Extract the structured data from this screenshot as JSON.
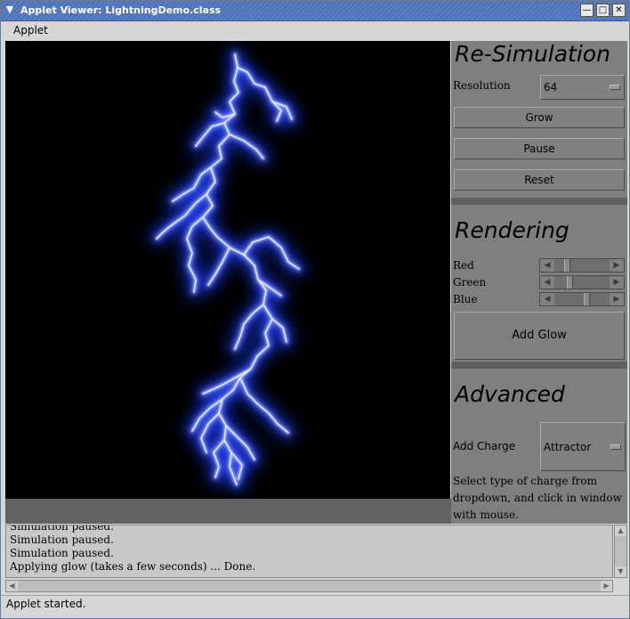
{
  "window": {
    "title": "Applet Viewer: LightningDemo.class",
    "icon": "chevron-down-icon",
    "controls": [
      "minimize-icon",
      "maximize-icon",
      "close-icon"
    ]
  },
  "menubar": {
    "items": [
      {
        "label": "Applet"
      }
    ]
  },
  "panel": {
    "resimulation": {
      "title": "Re-Simulation",
      "resolution_label": "Resolution",
      "resolution_value": "64",
      "grow": "Grow",
      "pause": "Pause",
      "reset": "Reset"
    },
    "rendering": {
      "title": "Rendering",
      "sliders": [
        {
          "label": "Red",
          "value": 0.2
        },
        {
          "label": "Green",
          "value": 0.25
        },
        {
          "label": "Blue",
          "value": 0.6
        }
      ],
      "add_glow": "Add Glow"
    },
    "advanced": {
      "title": "Advanced",
      "add_charge_label": "Add Charge",
      "charge_type": "Attractor",
      "description": "Select type of charge from dropdown, and click in window with mouse."
    }
  },
  "log": {
    "lines": [
      "Simulation paused.",
      "Simulation paused.",
      "Simulation paused.",
      "Applying glow (takes a few seconds) ... Done."
    ]
  },
  "status": {
    "text": "Applet started."
  },
  "colors": {
    "lightning_core": "#ffffff",
    "lightning_glow": "#3d5cff",
    "panel": "#7f7f7f",
    "canvas": "#000000"
  }
}
